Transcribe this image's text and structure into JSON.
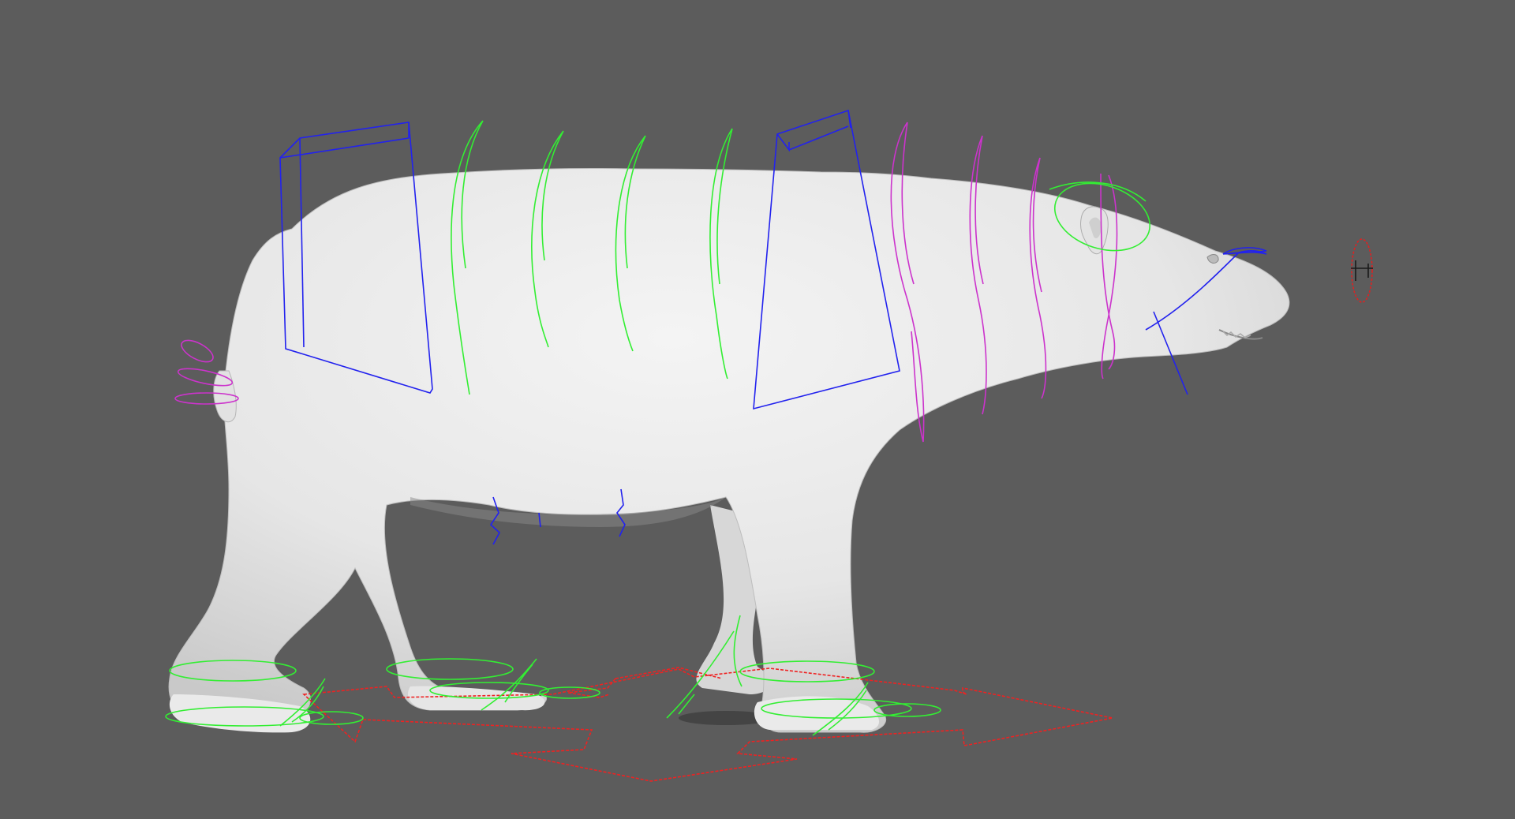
{
  "viewport": {
    "background": "#5c5c5c",
    "shading": "smooth-shaded",
    "subject": "polar-bear-rig"
  },
  "colors": {
    "model": "#e9e9e9",
    "model_shadow": "#9a9a9a",
    "fk_spine": "#33ee33",
    "neck": "#cc33cc",
    "box_ctrl": "#2222ee",
    "main_ctrl": "#ee2222",
    "look_at": "#dd2222"
  },
  "icons": {
    "main_control": "four-arrow-move-icon",
    "look_at": "eye-target-icon"
  }
}
